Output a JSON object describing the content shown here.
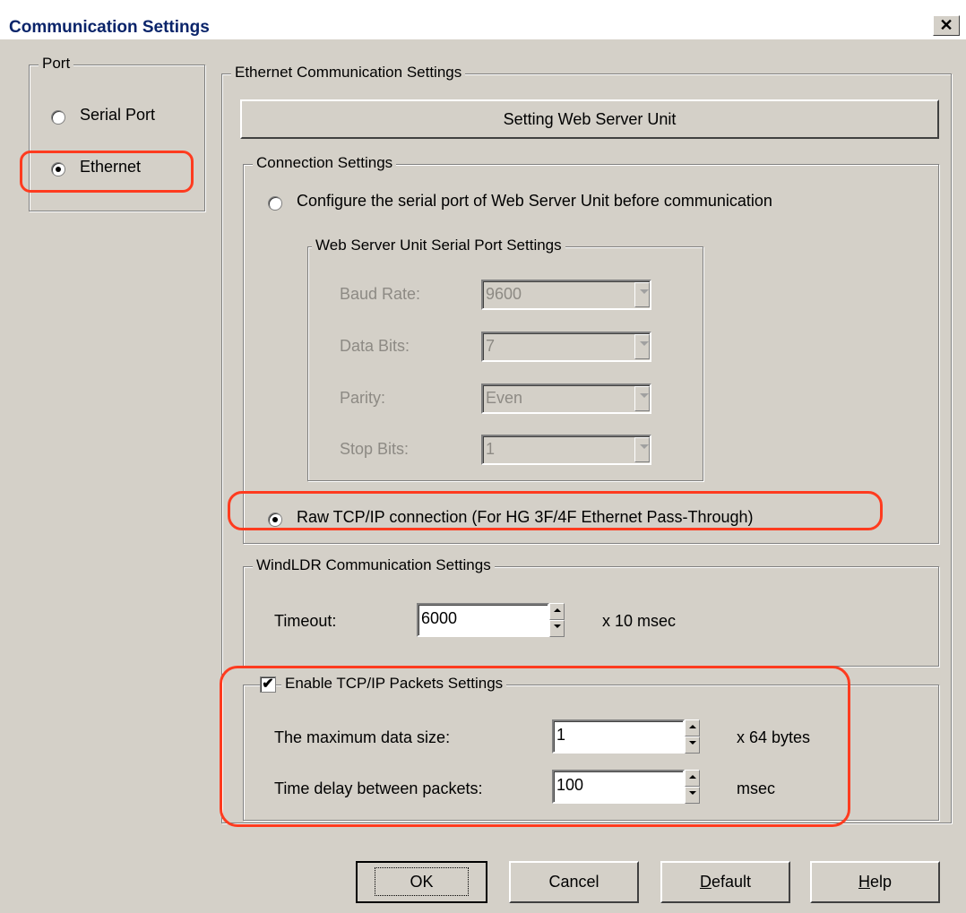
{
  "window": {
    "title": "Communication Settings",
    "close_glyph": "✕"
  },
  "port": {
    "legend": "Port",
    "serial_label": "Serial Port",
    "ethernet_label": "Ethernet",
    "selected": "Ethernet"
  },
  "ethernet": {
    "legend": "Ethernet Communication Settings",
    "setting_web_server_button": "Setting Web Server Unit",
    "connection": {
      "legend": "Connection Settings",
      "configure_label": "Configure the serial port of Web Server Unit before communication",
      "serial_settings": {
        "legend": "Web Server Unit Serial Port Settings",
        "baud_rate_label": "Baud Rate:",
        "baud_rate_value": "9600",
        "data_bits_label": "Data Bits:",
        "data_bits_value": "7",
        "parity_label": "Parity:",
        "parity_value": "Even",
        "stop_bits_label": "Stop Bits:",
        "stop_bits_value": "1"
      },
      "raw_tcp_label": "Raw TCP/IP connection (For HG 3F/4F Ethernet Pass-Through)",
      "selected": "raw_tcp"
    },
    "windldr": {
      "legend": "WindLDR Communication Settings",
      "timeout_label": "Timeout:",
      "timeout_value": "6000",
      "timeout_unit": "x 10 msec"
    },
    "packets": {
      "enable_label": "Enable TCP/IP Packets Settings",
      "enabled": true,
      "max_size_label": "The maximum data size:",
      "max_size_value": "1",
      "max_size_unit": "x 64 bytes",
      "delay_label": "Time delay between packets:",
      "delay_value": "100",
      "delay_unit": "msec"
    }
  },
  "buttons": {
    "ok": "OK",
    "cancel": "Cancel",
    "default_prefix": "D",
    "default_rest": "efault",
    "help_prefix": "H",
    "help_rest": "elp"
  },
  "colors": {
    "title_text": "#0a246a",
    "dialog_bg": "#d4d0c8",
    "highlight": "#ff3b1f",
    "disabled_text": "#8d8a84"
  }
}
